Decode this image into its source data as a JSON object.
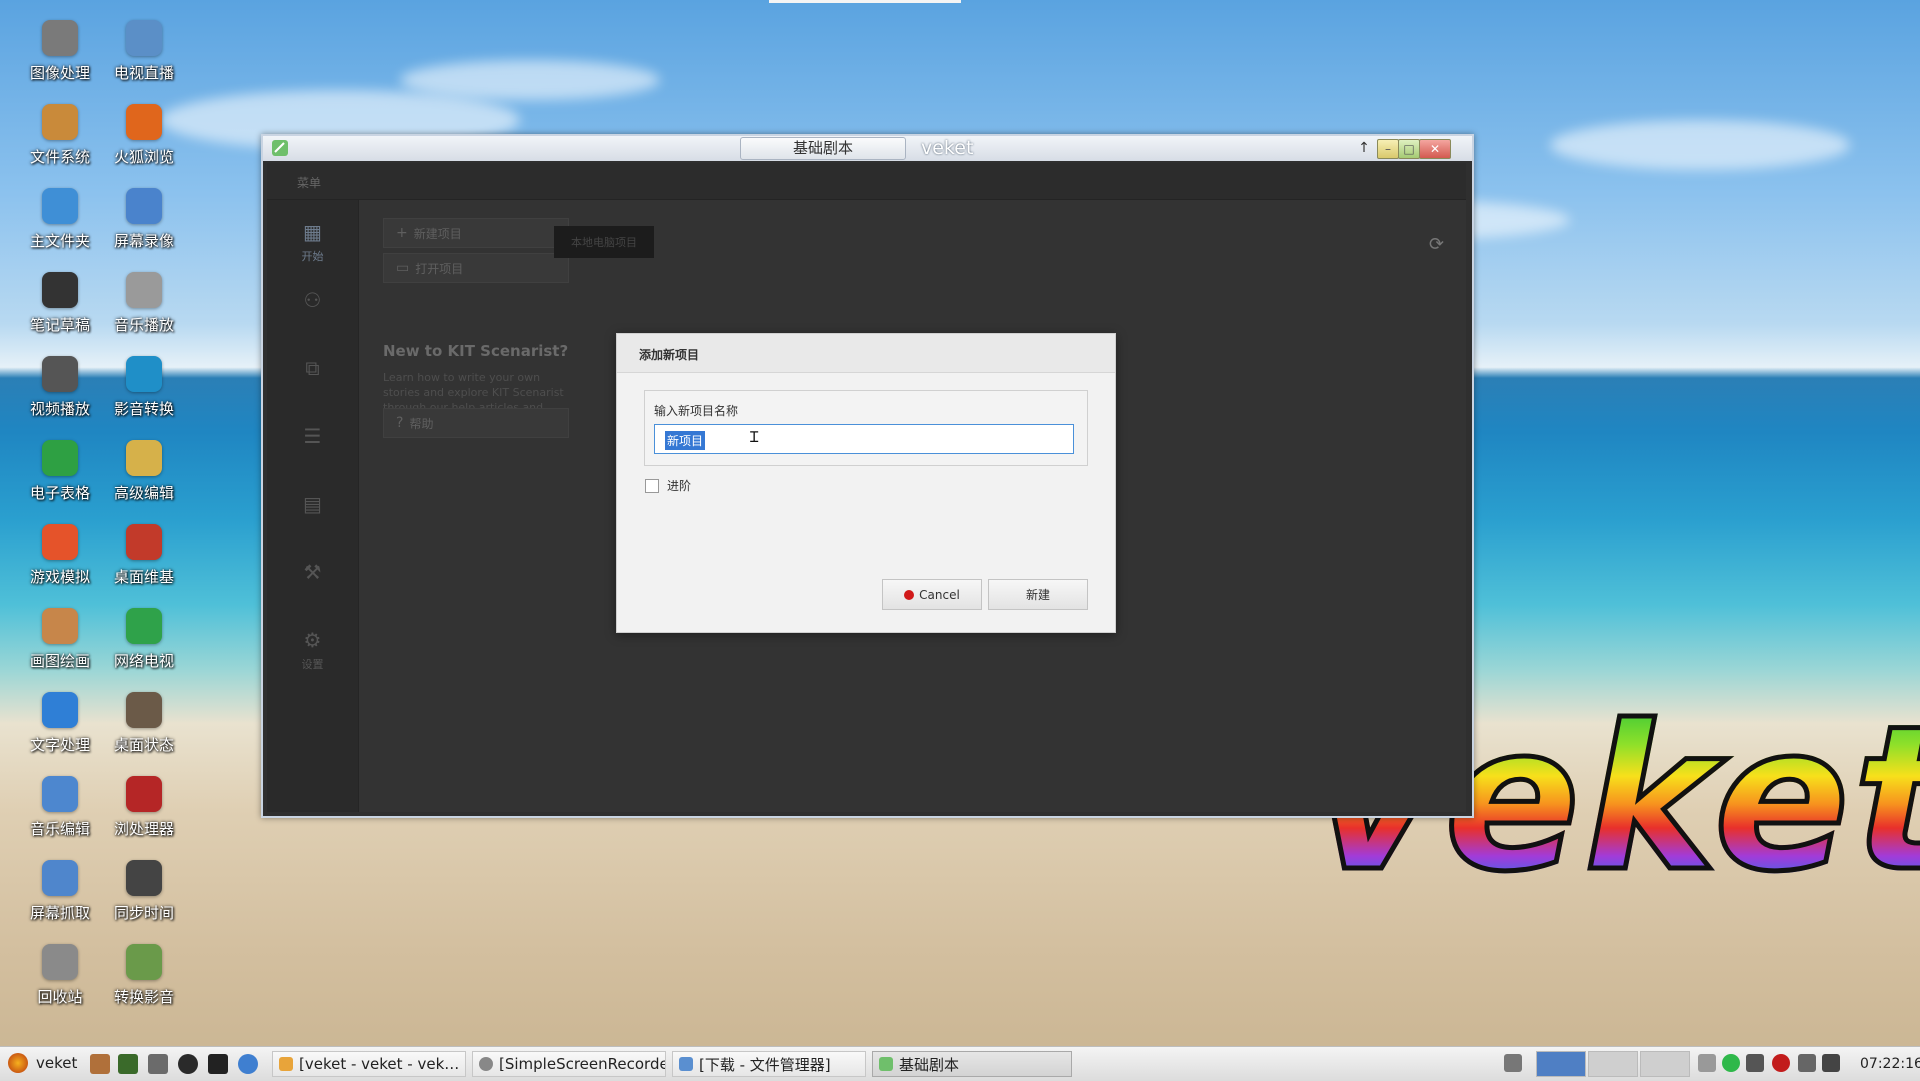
{
  "desktop": {
    "icons": [
      {
        "label": "图像处理",
        "icon": "image-editor-icon",
        "color": "#7a7a7a"
      },
      {
        "label": "电视直播",
        "icon": "tv-icon",
        "color": "#5b8fc7"
      },
      {
        "label": "文件系统",
        "icon": "filesystem-icon",
        "color": "#c98a3a"
      },
      {
        "label": "火狐浏览",
        "icon": "firefox-icon",
        "color": "#e0661c"
      },
      {
        "label": "主文件夹",
        "icon": "home-folder-icon",
        "color": "#3f8fd6"
      },
      {
        "label": "屏幕录像",
        "icon": "screen-record-icon",
        "color": "#4a83cc"
      },
      {
        "label": "笔记草稿",
        "icon": "notes-icon",
        "color": "#333333"
      },
      {
        "label": "音乐播放",
        "icon": "speaker-icon",
        "color": "#9a9a9a"
      },
      {
        "label": "视频播放",
        "icon": "video-player-icon",
        "color": "#555555"
      },
      {
        "label": "影音转换",
        "icon": "media-convert-icon",
        "color": "#1f8fc8"
      },
      {
        "label": "电子表格",
        "icon": "spreadsheet-icon",
        "color": "#2ea043"
      },
      {
        "label": "高级编辑",
        "icon": "editor-icon",
        "color": "#d6b14a"
      },
      {
        "label": "游戏模拟",
        "icon": "game-icon",
        "color": "#e5532a"
      },
      {
        "label": "桌面维基",
        "icon": "wiki-icon",
        "color": "#c23a2a"
      },
      {
        "label": "画图绘画",
        "icon": "paint-icon",
        "color": "#c7864a"
      },
      {
        "label": "网络电视",
        "icon": "play-icon",
        "color": "#2fa24a"
      },
      {
        "label": "文字处理",
        "icon": "word-processor-icon",
        "color": "#2f7fd6"
      },
      {
        "label": "桌面状态",
        "icon": "status-dial-icon",
        "color": "#6b5a48"
      },
      {
        "label": "音乐编辑",
        "icon": "audio-editor-icon",
        "color": "#4d87cf"
      },
      {
        "label": "浏处理器",
        "icon": "processor-icon",
        "color": "#b52626"
      },
      {
        "label": "屏幕抓取",
        "icon": "screenshot-icon",
        "color": "#4f86cc"
      },
      {
        "label": "同步时间",
        "icon": "calendar-icon",
        "color": "#444444"
      },
      {
        "label": "回收站",
        "icon": "trash-icon",
        "color": "#8a8a8a"
      },
      {
        "label": "转换影音",
        "icon": "convert-media-icon",
        "color": "#6a9a4a"
      }
    ],
    "logo_text": "veket"
  },
  "window": {
    "title_tab": "基础剧本",
    "title_right": "veket",
    "controls": {
      "up": "↑",
      "minimize": "–",
      "maximize": "□",
      "close": "✕"
    }
  },
  "app": {
    "menu": "菜单",
    "nav": [
      {
        "label": "开始",
        "icon": "grid-icon",
        "active": true
      },
      {
        "label": "",
        "icon": "structure-icon",
        "active": false
      },
      {
        "label": "",
        "icon": "cards-icon",
        "active": false
      },
      {
        "label": "",
        "icon": "script-icon",
        "active": false
      },
      {
        "label": "",
        "icon": "statistics-icon",
        "active": false
      },
      {
        "label": "",
        "icon": "tools-icon",
        "active": false
      },
      {
        "label": "设置",
        "icon": "gear-icon",
        "active": false
      }
    ],
    "new_project": "新建项目",
    "open_project": "打开项目",
    "local_projects": "本地电脑项目",
    "hint_title": "New to KIT Scenarist?",
    "hint_body": "Learn how to write your own stories and explore KIT Scenarist through our help articles and tutorials.",
    "help": "帮助"
  },
  "dialog": {
    "title": "添加新项目",
    "field_label": "输入新项目名称",
    "field_value": "新项目",
    "advanced_label": "进阶",
    "advanced_checked": false,
    "cancel": "Cancel",
    "create": "新建"
  },
  "taskbar": {
    "start_label": "veket",
    "tasks": [
      {
        "label": "[veket - veket - vek…",
        "active": false
      },
      {
        "label": "[SimpleScreenRecorder]",
        "active": false
      },
      {
        "label": "[下载 - 文件管理器]",
        "active": false
      },
      {
        "label": "基础剧本",
        "active": true
      }
    ],
    "clock": "07:22:16"
  }
}
